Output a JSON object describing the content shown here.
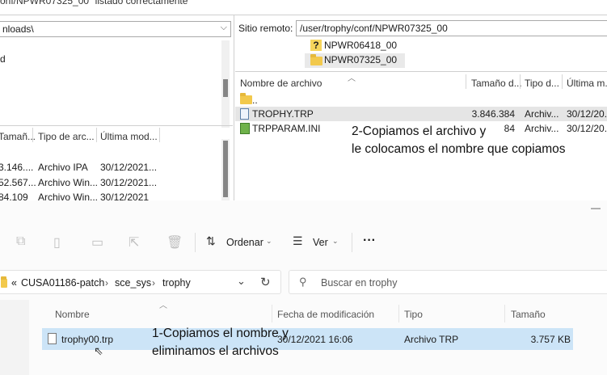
{
  "filezilla": {
    "status_text": "onf/NPWR07325_00\" listado correctamente",
    "local": {
      "path_value": "nloads\\",
      "tree_item": "d",
      "columns": [
        "Tamañ...",
        "Tipo de arc...",
        "Última mod..."
      ],
      "rows": [
        {
          "size": "3.146....",
          "type": "Archivo IPA",
          "date": "30/12/2021..."
        },
        {
          "size": "52.567...",
          "type": "Archivo Win...",
          "date": "30/12/2021..."
        },
        {
          "size": "84.109",
          "type": "Archivo Win...",
          "date": "30/12/2021"
        }
      ]
    },
    "remote": {
      "site_label": "Sitio remoto:",
      "site_value": "/user/trophy/conf/NPWR07325_00",
      "tree": [
        {
          "name": "NPWR06418_00",
          "icon": "question-folder-icon"
        },
        {
          "name": "NPWR07325_00",
          "icon": "folder-icon"
        }
      ],
      "columns": [
        "Nombre de archivo",
        "Tamaño d...",
        "Tipo d...",
        "Última m..."
      ],
      "rows": [
        {
          "name": "..",
          "size": "",
          "type": "",
          "date": "",
          "icon": "folder-icon"
        },
        {
          "name": "TROPHY.TRP",
          "size": "3.846.384",
          "type": "Archiv...",
          "date": "30/12/20...",
          "icon": "file-icon"
        },
        {
          "name": "TRPPARAM.INI",
          "size": "84",
          "type": "Archiv...",
          "date": "30/12/20...",
          "icon": "ini-file-icon"
        }
      ]
    },
    "annotation_2": {
      "line1": "2-Copiamos el archivo y",
      "line2": "le colocamos el nombre que copiamos"
    }
  },
  "explorer": {
    "window_minimize": "—",
    "toolbar": {
      "sort_label": "Ordenar",
      "view_label": "Ver",
      "more_label": "···"
    },
    "address": {
      "root_marker": "«",
      "crumbs": [
        "CUSA01186-patch",
        "sce_sys",
        "trophy"
      ],
      "search_placeholder": "Buscar en trophy"
    },
    "columns": {
      "name": "Nombre",
      "modified": "Fecha de modificación",
      "type": "Tipo",
      "size": "Tamaño"
    },
    "files": [
      {
        "name": "trophy00.trp",
        "modified": "30/12/2021 16:06",
        "type": "Archivo TRP",
        "size": "3.757 KB"
      }
    ],
    "annotation_1": {
      "line1": "1-Copiamos el nombre y",
      "line2": "eliminamos el archivos"
    }
  }
}
